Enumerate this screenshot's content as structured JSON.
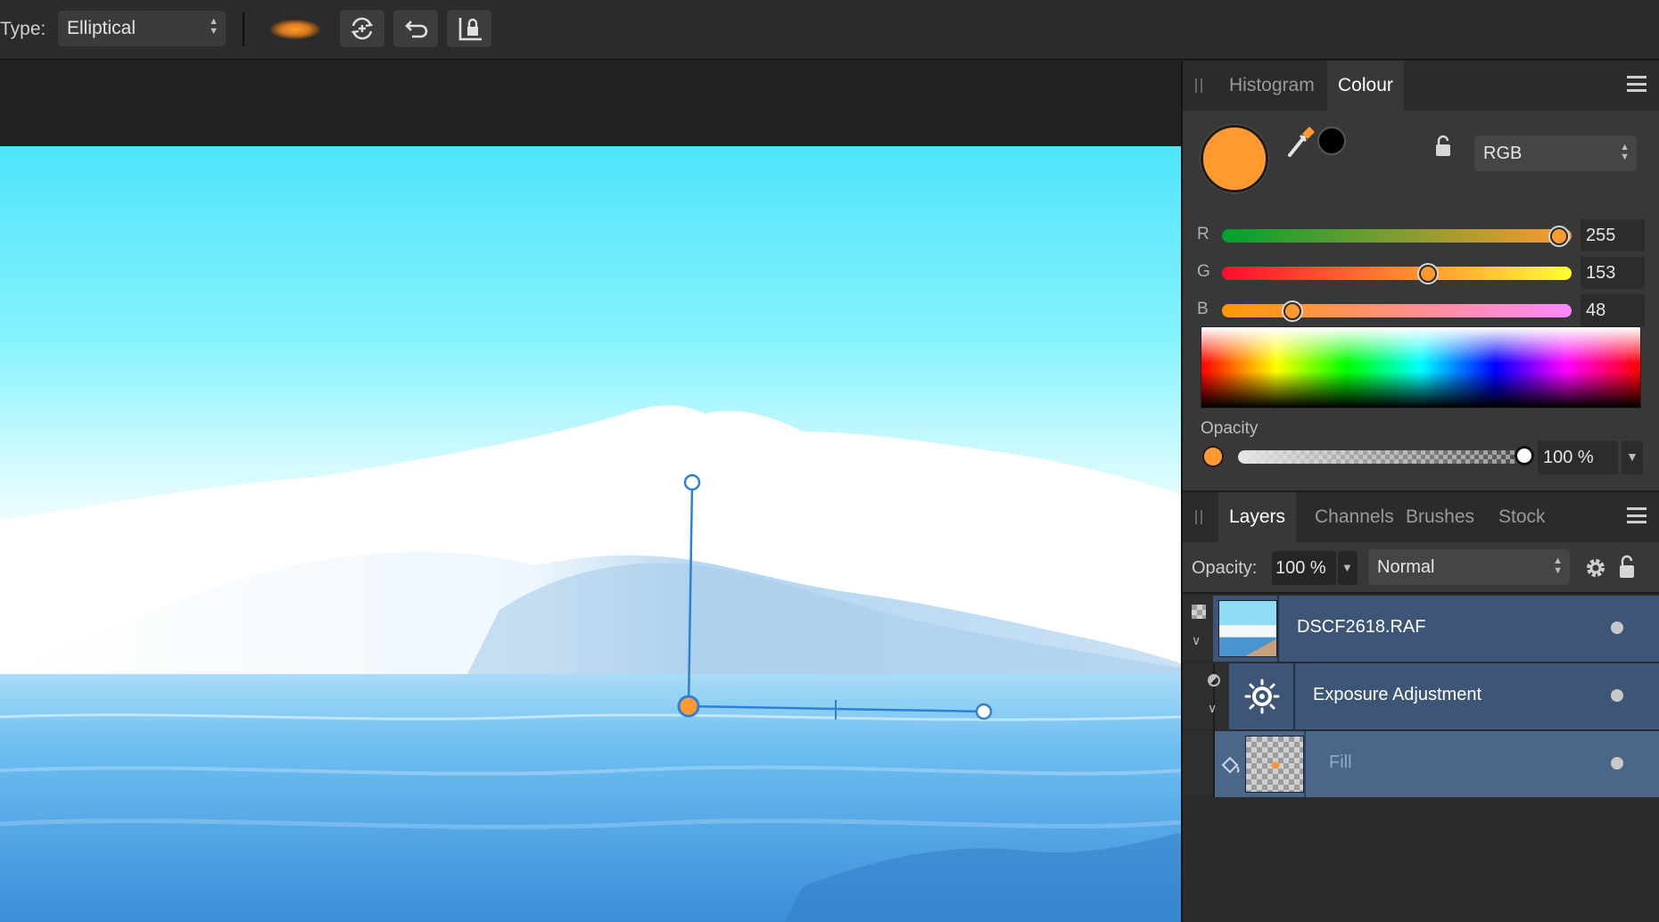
{
  "toolbar": {
    "type_label": "Type:",
    "type_value": "Elliptical"
  },
  "colour_panel": {
    "tabs": [
      "Histogram",
      "Colour"
    ],
    "active_tab": "Colour",
    "primary_color": "#FF9930",
    "secondary_color": "#000000",
    "model": "RGB",
    "channels": [
      {
        "label": "R",
        "value": "255",
        "fraction": 1.0
      },
      {
        "label": "G",
        "value": "153",
        "fraction": 0.6
      },
      {
        "label": "B",
        "value": "48",
        "fraction": 0.188
      }
    ],
    "opacity_label": "Opacity",
    "opacity_value": "100 %"
  },
  "layers_panel": {
    "tabs": [
      "Layers",
      "Channels",
      "Brushes",
      "Stock"
    ],
    "active_tab": "Layers",
    "opacity_label": "Opacity:",
    "opacity_value": "100 %",
    "blend_mode": "Normal",
    "layers": [
      {
        "name": "DSCF2618.RAF"
      },
      {
        "name": "Exposure Adjustment"
      },
      {
        "name": "Fill"
      }
    ]
  },
  "icons": [
    "chevron-updown-icon",
    "gradient-preview-icon",
    "reverse-gradient-icon",
    "undo-arrow-icon",
    "lock-aspect-icon",
    "color-picker-icon",
    "lock-icon",
    "hamburger-menu-icon",
    "gear-icon",
    "sun-icon",
    "fill-bucket-icon",
    "visibility-dot-icon",
    "expand-chevron-icon"
  ],
  "accent_colors": {
    "handle_blue": "#2F7FD6",
    "selection_row": "#3D5576",
    "active_row": "#4A6789"
  }
}
